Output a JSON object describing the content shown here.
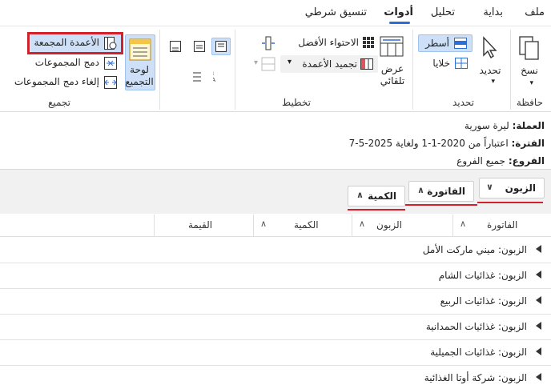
{
  "tabs": [
    "ملف",
    "بداية",
    "تحليل",
    "أدوات",
    "تنسيق شرطي"
  ],
  "active_tab": "أدوات",
  "ribbon": {
    "clipboard": {
      "label": "حافظة",
      "copy": "نسخ"
    },
    "select": {
      "label": "تحديد",
      "select_btn": "تحديد",
      "rows": "أسطر",
      "cells": "خلايا"
    },
    "layout": {
      "label": "تخطيط",
      "best_fit": "الاحتواء الأفضل",
      "freeze": "تجميد الأعمدة",
      "autofit": "عرض تلقائي"
    },
    "grouping": {
      "label": "تجميع",
      "panel": "لوحة التجميع",
      "grouped_columns": "الأعمدة المجمعة",
      "merge_groups": "دمج المجموعات",
      "unmerge_groups": "إلغاء دمج المجموعات"
    }
  },
  "info": {
    "currency_label": "العملة:",
    "currency_value": "ليرة سورية",
    "period_label": "الفترة:",
    "period_value": "اعتباراً من 2020-1-1 ولغاية 2025-5-7",
    "branches_label": "الفروع:",
    "branches_value": "جميع الفروع"
  },
  "group_chips": [
    "الزبون",
    "الفاتورة",
    "الكمية"
  ],
  "columns": [
    "الفاتورة",
    "الزبون",
    "الكمية",
    "القيمة"
  ],
  "rows": [
    "الزبون: ميني ماركت الأمل",
    "الزبون: غذائيات الشام",
    "الزبون: غذائيات الربيع",
    "الزبون: غذائيات الحمدانية",
    "الزبون: غذائيات الجميلية",
    "الزبون: شركة أوتا الغذائية"
  ],
  "colors": {
    "accent": "#2b6fd6",
    "highlight": "#d3202a",
    "selected": "#cde0f7"
  }
}
